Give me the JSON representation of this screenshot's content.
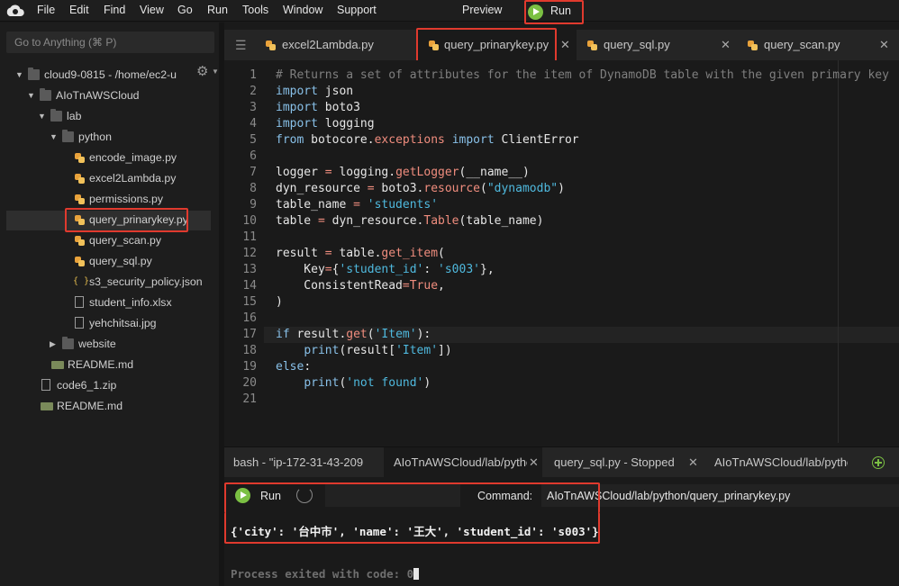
{
  "menubar": {
    "items": [
      "File",
      "Edit",
      "Find",
      "View",
      "Go",
      "Run",
      "Tools",
      "Window",
      "Support"
    ],
    "preview": "Preview",
    "run": "Run"
  },
  "sidebar": {
    "search_placeholder": "Go to Anything (⌘ P)",
    "tree": [
      {
        "label": "cloud9-0815 - /home/ec2-u",
        "type": "folder",
        "expanded": true
      },
      {
        "label": "AIoTnAWSCloud",
        "type": "folder",
        "expanded": true
      },
      {
        "label": "lab",
        "type": "folder",
        "expanded": true
      },
      {
        "label": "python",
        "type": "folder",
        "expanded": true
      },
      {
        "label": "encode_image.py",
        "type": "py"
      },
      {
        "label": "excel2Lambda.py",
        "type": "py"
      },
      {
        "label": "permissions.py",
        "type": "py"
      },
      {
        "label": "query_prinarykey.py",
        "type": "py",
        "selected": true
      },
      {
        "label": "query_scan.py",
        "type": "py"
      },
      {
        "label": "query_sql.py",
        "type": "py"
      },
      {
        "label": "s3_security_policy.json",
        "type": "json"
      },
      {
        "label": "student_info.xlsx",
        "type": "file"
      },
      {
        "label": "yehchitsai.jpg",
        "type": "image"
      },
      {
        "label": "website",
        "type": "folder",
        "expanded": false
      },
      {
        "label": "README.md",
        "type": "md"
      },
      {
        "label": "code6_1.zip",
        "type": "zip"
      },
      {
        "label": "README.md",
        "type": "md"
      }
    ]
  },
  "editor": {
    "tabs": [
      {
        "label": "excel2Lambda.py",
        "active": false
      },
      {
        "label": "query_prinarykey.py",
        "active": true
      },
      {
        "label": "query_sql.py",
        "active": false
      },
      {
        "label": "query_scan.py",
        "active": false
      }
    ],
    "line_numbers": [
      "1",
      "2",
      "3",
      "4",
      "5",
      "6",
      "7",
      "8",
      "9",
      "10",
      "11",
      "12",
      "13",
      "14",
      "15",
      "16",
      "17",
      "18",
      "19",
      "20",
      "21"
    ],
    "lines": [
      [
        {
          "t": "# Returns a set of attributes for the item of DynamoDB table with the given primary key",
          "c": "com"
        }
      ],
      [
        {
          "t": "import",
          "c": "kw"
        },
        {
          "t": " json",
          "c": ""
        }
      ],
      [
        {
          "t": "import",
          "c": "kw"
        },
        {
          "t": " boto3",
          "c": ""
        }
      ],
      [
        {
          "t": "import",
          "c": "kw"
        },
        {
          "t": " logging",
          "c": ""
        }
      ],
      [
        {
          "t": "from",
          "c": "kw"
        },
        {
          "t": " botocore.",
          "c": ""
        },
        {
          "t": "exceptions",
          "c": "fn"
        },
        {
          "t": " ",
          "c": ""
        },
        {
          "t": "import",
          "c": "kw"
        },
        {
          "t": " ClientError",
          "c": ""
        }
      ],
      [],
      [
        {
          "t": "logger ",
          "c": ""
        },
        {
          "t": "=",
          "c": "op"
        },
        {
          "t": " logging.",
          "c": ""
        },
        {
          "t": "getLogger",
          "c": "fn"
        },
        {
          "t": "(__name__)",
          "c": ""
        }
      ],
      [
        {
          "t": "dyn_resource ",
          "c": ""
        },
        {
          "t": "=",
          "c": "op"
        },
        {
          "t": " boto3.",
          "c": ""
        },
        {
          "t": "resource",
          "c": "fn"
        },
        {
          "t": "(",
          "c": ""
        },
        {
          "t": "\"dynamodb\"",
          "c": "str"
        },
        {
          "t": ")",
          "c": ""
        }
      ],
      [
        {
          "t": "table_name ",
          "c": ""
        },
        {
          "t": "=",
          "c": "op"
        },
        {
          "t": " ",
          "c": ""
        },
        {
          "t": "'students'",
          "c": "str"
        }
      ],
      [
        {
          "t": "table ",
          "c": ""
        },
        {
          "t": "=",
          "c": "op"
        },
        {
          "t": " dyn_resource.",
          "c": ""
        },
        {
          "t": "Table",
          "c": "fn"
        },
        {
          "t": "(table_name)",
          "c": ""
        }
      ],
      [],
      [
        {
          "t": "result ",
          "c": ""
        },
        {
          "t": "=",
          "c": "op"
        },
        {
          "t": " table.",
          "c": ""
        },
        {
          "t": "get_item",
          "c": "fn"
        },
        {
          "t": "(",
          "c": ""
        }
      ],
      [
        {
          "t": "    Key",
          "c": ""
        },
        {
          "t": "=",
          "c": "op"
        },
        {
          "t": "{",
          "c": ""
        },
        {
          "t": "'student_id'",
          "c": "str"
        },
        {
          "t": ": ",
          "c": ""
        },
        {
          "t": "'s003'",
          "c": "str"
        },
        {
          "t": "},",
          "c": ""
        }
      ],
      [
        {
          "t": "    ConsistentRead",
          "c": ""
        },
        {
          "t": "=",
          "c": "op"
        },
        {
          "t": "True",
          "c": "fn"
        },
        {
          "t": ",",
          "c": ""
        }
      ],
      [
        {
          "t": ")",
          "c": ""
        }
      ],
      [],
      [
        {
          "t": "if",
          "c": "kw"
        },
        {
          "t": " result.",
          "c": ""
        },
        {
          "t": "get",
          "c": "fn"
        },
        {
          "t": "(",
          "c": ""
        },
        {
          "t": "'Item'",
          "c": "str"
        },
        {
          "t": "):",
          "c": ""
        }
      ],
      [
        {
          "t": "    ",
          "c": ""
        },
        {
          "t": "print",
          "c": "kw"
        },
        {
          "t": "(result[",
          "c": ""
        },
        {
          "t": "'Item'",
          "c": "str"
        },
        {
          "t": "])",
          "c": ""
        }
      ],
      [
        {
          "t": "else",
          "c": "kw"
        },
        {
          "t": ":",
          "c": ""
        }
      ],
      [
        {
          "t": "    ",
          "c": ""
        },
        {
          "t": "print",
          "c": "kw"
        },
        {
          "t": "(",
          "c": ""
        },
        {
          "t": "'not found'",
          "c": "str"
        },
        {
          "t": ")",
          "c": ""
        }
      ],
      []
    ]
  },
  "console": {
    "tabs": [
      {
        "label": "bash - \"ip-172-31-43-209",
        "active": false
      },
      {
        "label": "AIoTnAWSCloud/lab/pytho",
        "active": true
      },
      {
        "label": "query_sql.py - Stopped",
        "active": false
      },
      {
        "label": "AIoTnAWSCloud/lab/pytho",
        "active": false
      }
    ],
    "run_label": "Run",
    "command_label": "Command:",
    "command_value": "AIoTnAWSCloud/lab/python/query_prinarykey.py",
    "output": "{'city': '台中市', 'name': '王大', 'student_id': 's003'}",
    "exit_message": "Process exited with code: 0"
  },
  "colors": {
    "highlight": "#e03a2e",
    "run_green": "#7bc043",
    "keyword": "#88c0e8",
    "function": "#f08d7e",
    "string": "#4fb9de"
  }
}
